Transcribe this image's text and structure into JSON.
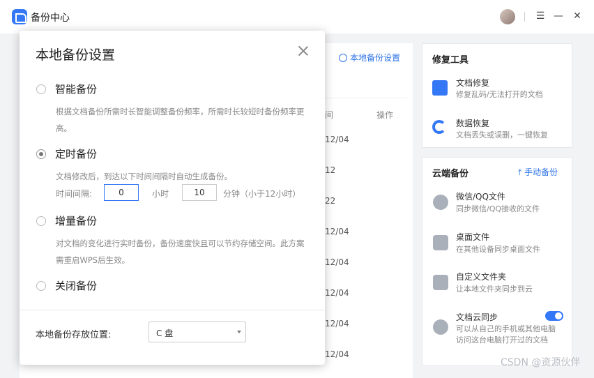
{
  "app": {
    "title": "备份中心"
  },
  "window": {
    "menu_glyph": "☰",
    "minimize_glyph": "—",
    "close_glyph": "✕"
  },
  "background": {
    "settings_link": "本地备份设置",
    "col_time": "间",
    "col_op": "操作",
    "time_rows": [
      "12/04",
      "12",
      "22",
      "12/04",
      "12/04",
      "12/04",
      "12/04",
      "12/04"
    ]
  },
  "repair_tools": {
    "title": "修复工具",
    "items": [
      {
        "name": "文档修复",
        "desc": "修复乱码/无法打开的文档",
        "icon": "document-repair-icon"
      },
      {
        "name": "数据恢复",
        "desc": "文档丢失或误删，一键恢复",
        "icon": "data-recovery-icon"
      }
    ]
  },
  "cloud_backup": {
    "title": "云端备份",
    "manual_backup": "手动备份",
    "items": [
      {
        "name": "微信/QQ文件",
        "desc": "同步微信/QQ接收的文件",
        "icon": "chat-icon"
      },
      {
        "name": "桌面文件",
        "desc": "在其他设备同步桌面文件",
        "icon": "desktop-icon"
      },
      {
        "name": "自定义文件夹",
        "desc": "让本地文件夹同步到云",
        "icon": "folder-icon"
      },
      {
        "name": "文档云同步",
        "desc": "可以从自己的手机或其他电脑",
        "desc2": "访问这台电脑打开过的文档",
        "icon": "cloud-sync-icon",
        "enabled": true
      }
    ]
  },
  "dialog": {
    "title": "本地备份设置",
    "options": [
      {
        "label": "智能备份",
        "desc": "根据文档备份所需时长智能调整备份频率，所需时长较短时备份频率更高。",
        "checked": false
      },
      {
        "label": "定时备份",
        "desc": "文档修改后，到达以下时间间隔时自动生成备份。",
        "checked": true
      },
      {
        "label": "增量备份",
        "desc": "对文档的变化进行实时备份，备份速度快且可以节约存储空间。此方案需重启WPS后生效。",
        "checked": false
      },
      {
        "label": "关闭备份",
        "checked": false
      }
    ],
    "interval": {
      "label": "时间间隔:",
      "hours_value": "0",
      "hours_unit": "小时",
      "minutes_value": "10",
      "minutes_unit": "分钟（小于12小时）"
    },
    "location": {
      "label": "本地备份存放位置:",
      "value": "C 盘"
    }
  },
  "watermark": "CSDN @资源伙伴",
  "colors": {
    "accent": "#3478f6",
    "link": "#2f74e6"
  }
}
